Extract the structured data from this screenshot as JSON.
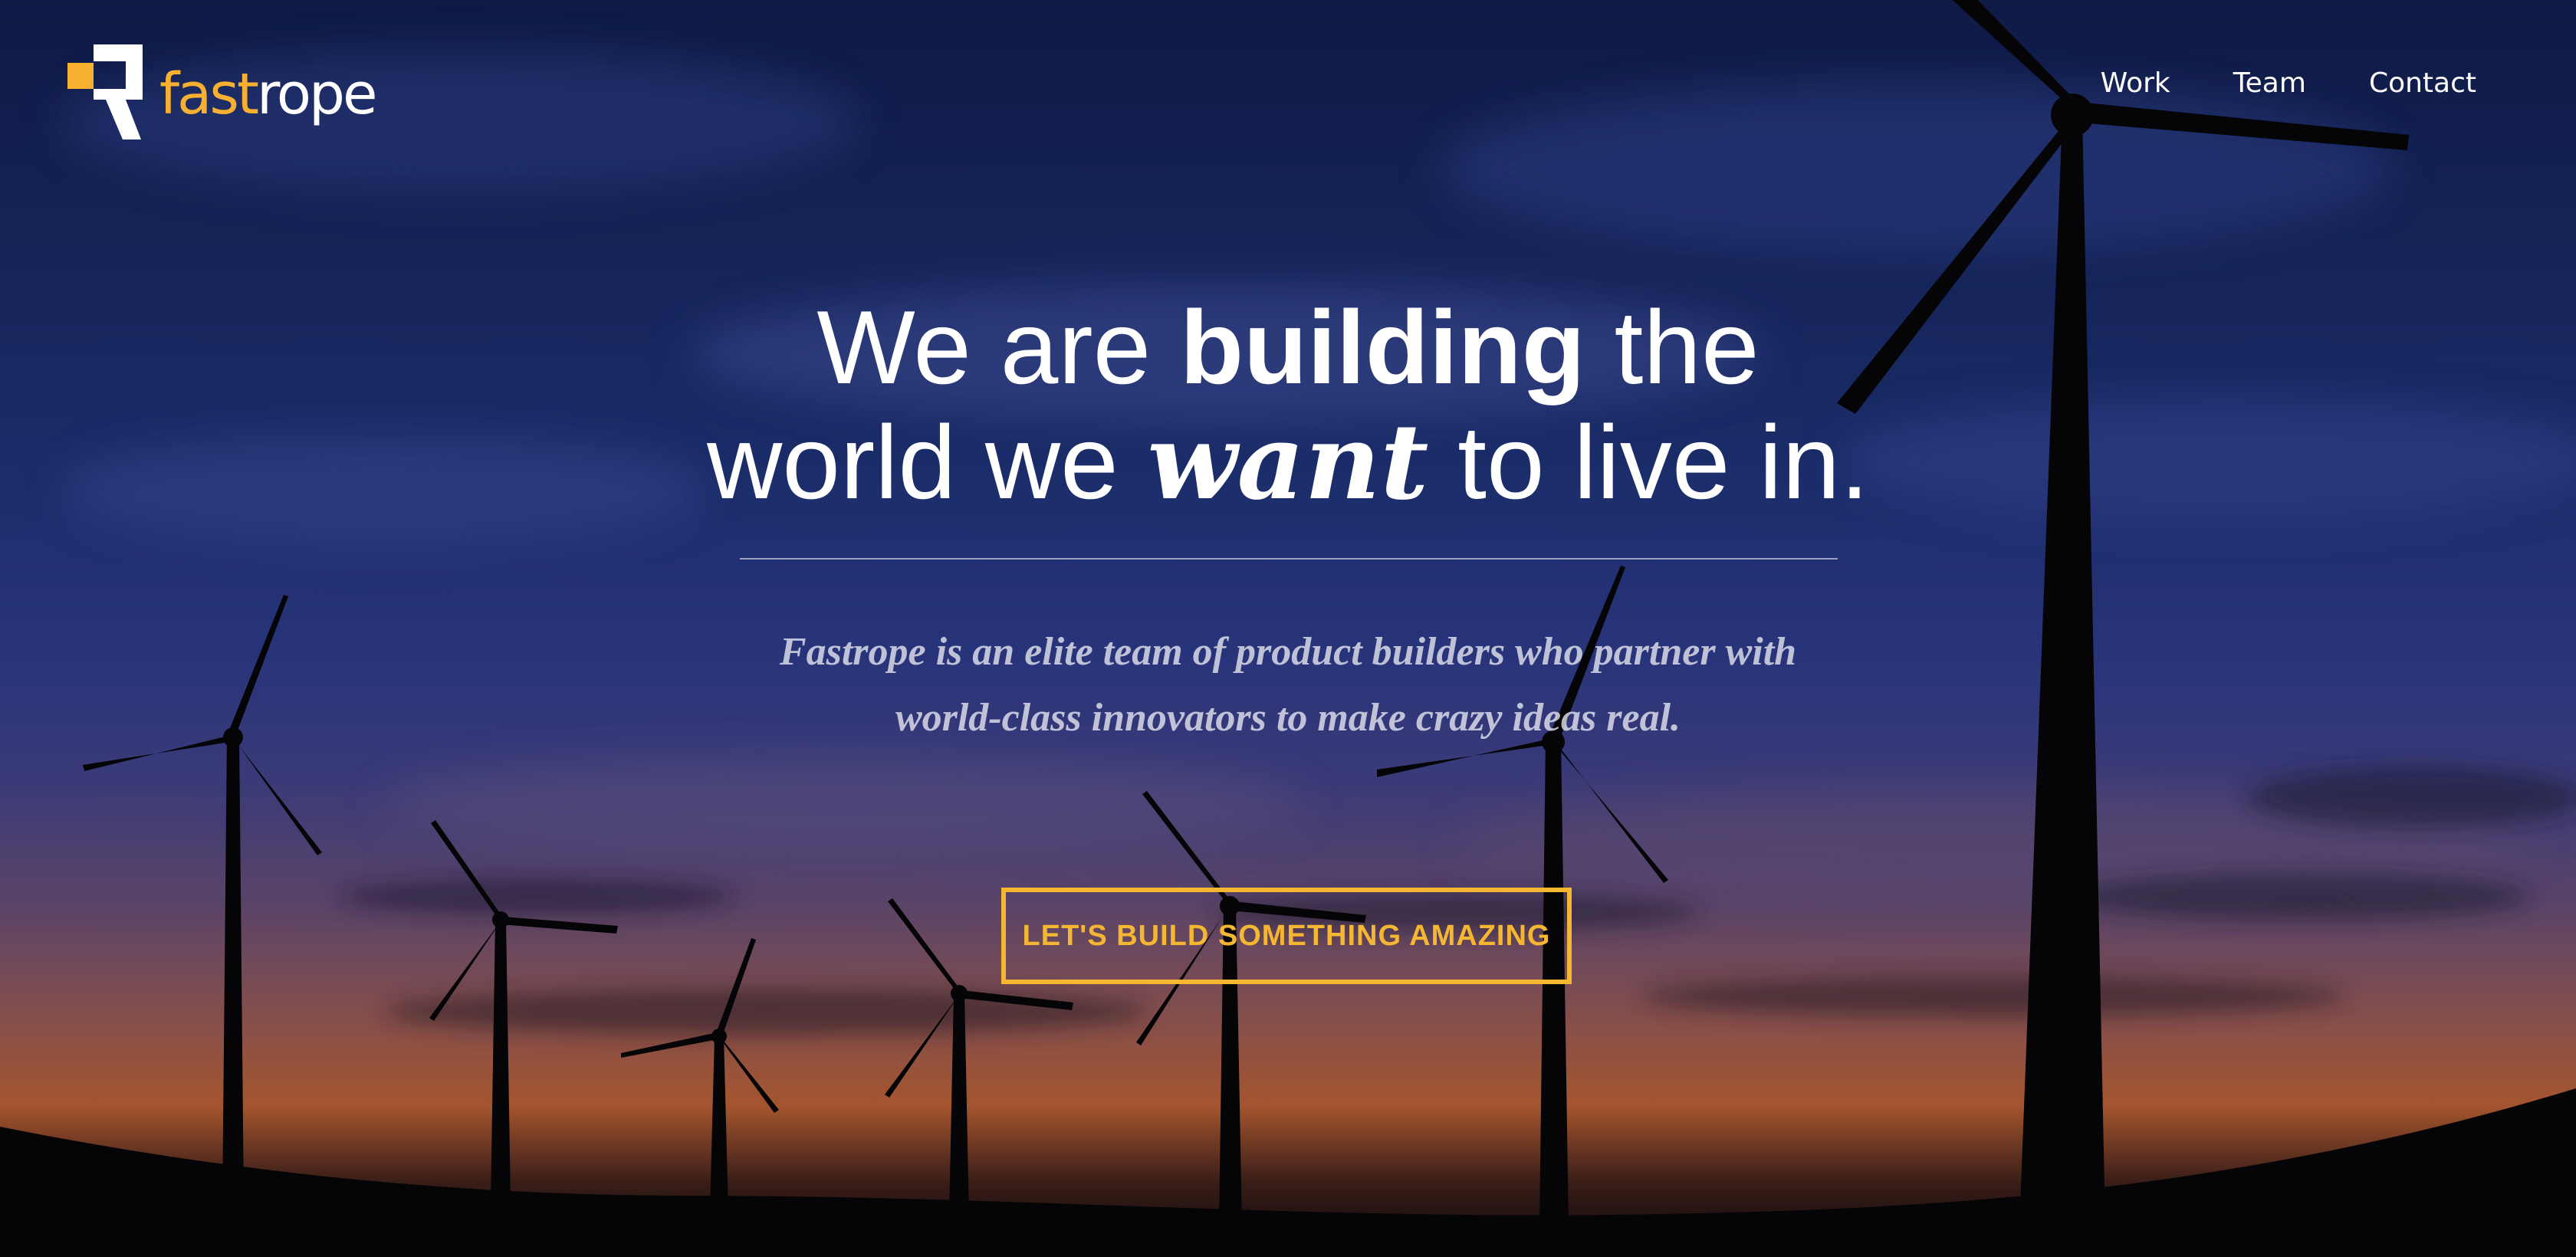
{
  "brand": {
    "name_part1": "fast",
    "name_part2": "rope",
    "logo_icon": "fastrope-logo-icon",
    "accent_color": "#f7b030"
  },
  "nav": {
    "items": [
      {
        "label": "Work"
      },
      {
        "label": "Team"
      },
      {
        "label": "Contact"
      }
    ]
  },
  "hero": {
    "headline_line1_a": "We are ",
    "headline_line1_strong": "building",
    "headline_line1_b": " the",
    "headline_line2_a": "world we ",
    "headline_line2_em": "want",
    "headline_line2_b": " to live in.",
    "tagline_line1": "Fastrope is an elite team of product builders who partner with",
    "tagline_line2": "world-class innovators to make crazy ideas real.",
    "cta_label": "LET'S BUILD SOMETHING AMAZING",
    "cta_color": "#f5b731"
  }
}
